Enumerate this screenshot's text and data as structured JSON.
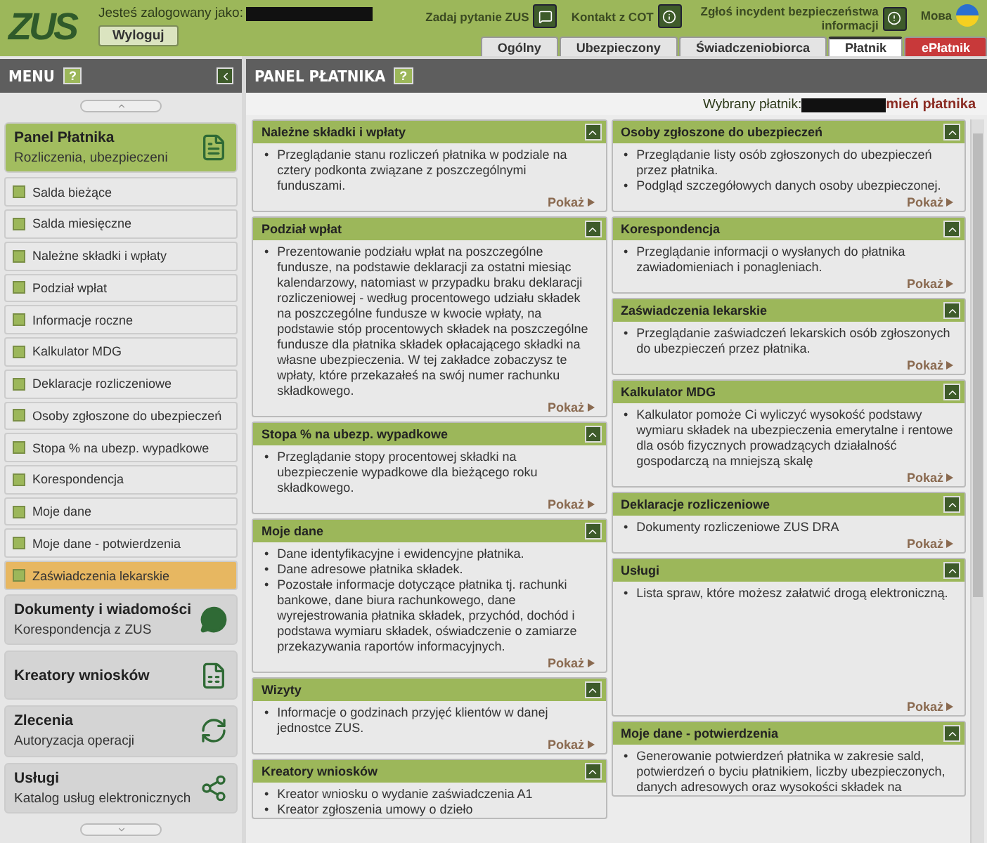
{
  "header": {
    "logo": "ZUS",
    "login_label": "Jesteś zalogowany jako:",
    "logout": "Wyloguj",
    "links": [
      {
        "label": "Zadaj pytanie ZUS",
        "kind": "chat"
      },
      {
        "label": "Kontakt z COT",
        "kind": "info"
      },
      {
        "label": "Zgłoś incydent bezpieczeństwa informacji",
        "kind": "alert"
      }
    ],
    "language": "Мова"
  },
  "tabs": [
    {
      "label": "Ogólny",
      "selected": false,
      "kind": "normal"
    },
    {
      "label": "Ubezpieczony",
      "selected": false,
      "kind": "normal"
    },
    {
      "label": "Świadczeniobiorca",
      "selected": false,
      "kind": "normal"
    },
    {
      "label": "Płatnik",
      "selected": true,
      "kind": "normal"
    },
    {
      "label": "ePłatnik",
      "selected": false,
      "kind": "highlight"
    }
  ],
  "sidebar": {
    "title": "MENU",
    "help": "?",
    "sections": [
      {
        "title": "Panel Płatnika",
        "subtitle": "Rozliczenia, ubezpieczeni",
        "kind": "document",
        "expanded": true,
        "items": [
          {
            "label": "Salda bieżące",
            "selected": false
          },
          {
            "label": "Salda miesięczne",
            "selected": false
          },
          {
            "label": "Należne składki i wpłaty",
            "selected": false
          },
          {
            "label": "Podział wpłat",
            "selected": false
          },
          {
            "label": "Informacje roczne",
            "selected": false
          },
          {
            "label": "Kalkulator MDG",
            "selected": false
          },
          {
            "label": "Deklaracje rozliczeniowe",
            "selected": false
          },
          {
            "label": "Osoby zgłoszone do ubezpieczeń",
            "selected": false
          },
          {
            "label": "Stopa % na ubezp. wypadkowe",
            "selected": false
          },
          {
            "label": "Korespondencja",
            "selected": false
          },
          {
            "label": "Moje dane",
            "selected": false
          },
          {
            "label": "Moje dane - potwierdzenia",
            "selected": false
          },
          {
            "label": "Zaświadczenia lekarskie",
            "selected": true
          }
        ]
      },
      {
        "title": "Dokumenty i wiadomości",
        "subtitle": "Korespondencja z ZUS",
        "kind": "chat",
        "expanded": false
      },
      {
        "title": "Kreatory wniosków",
        "kind": "form",
        "expanded": false
      },
      {
        "title": "Zlecenia",
        "subtitle": "Autoryzacja operacji",
        "kind": "refresh",
        "expanded": false
      },
      {
        "title": "Usługi",
        "subtitle": "Katalog usług elektronicznych",
        "kind": "network",
        "expanded": false
      }
    ]
  },
  "main": {
    "bullet_marker": "•",
    "title": "PANEL PŁATNIKA",
    "help": "?",
    "payer_label": "Wybrany płatnik:",
    "change_payer": "mień płatnika",
    "left_cards": [
      {
        "title": "Należne składki i wpłaty",
        "bullets": [
          "Przeglądanie stanu rozliczeń płatnika w podziale na cztery podkonta związane z poszczególnymi funduszami."
        ],
        "link": "Pokaż"
      },
      {
        "title": "Podział wpłat",
        "bullets": [
          "Prezentowanie podziału wpłat na poszczególne fundusze, na podstawie deklaracji za ostatni miesiąc kalendarzowy, natomiast w przypadku braku deklaracji rozliczeniowej - według procentowego udziału składek na poszczególne fundusze w kwocie wpłaty, na podstawie stóp procentowych składek na poszczególne fundusze dla płatnika składek opłacającego składki na własne ubezpieczenia. W tej zakładce zobaczysz te wpłaty, które przekazałeś na swój numer rachunku składkowego."
        ],
        "link": "Pokaż"
      },
      {
        "title": "Stopa % na ubezp. wypadkowe",
        "bullets": [
          "Przeglądanie stopy procentowej składki na ubezpieczenie wypadkowe dla bieżącego roku składkowego."
        ],
        "link": "Pokaż"
      },
      {
        "title": "Moje dane",
        "bullets": [
          "Dane identyfikacyjne i ewidencyjne płatnika.",
          "Dane adresowe płatnika składek.",
          "Pozostałe informacje dotyczące płatnika tj. rachunki bankowe, dane biura rachunkowego, dane wyrejestrowania płatnika składek, przychód, dochód i podstawa wymiaru składek, oświadczenie o zamiarze przekazywania raportów informacyjnych."
        ],
        "link": "Pokaż"
      },
      {
        "title": "Wizyty",
        "bullets": [
          "Informacje o godzinach przyjęć klientów w danej jednostce ZUS."
        ],
        "link": "Pokaż"
      },
      {
        "title": "Kreatory wniosków",
        "bullets": [
          "Kreator wniosku o wydanie zaświadczenia A1",
          "Kreator zgłoszenia umowy o dzieło"
        ]
      }
    ],
    "right_cards": [
      {
        "title": "Osoby zgłoszone do ubezpieczeń",
        "bullets": [
          "Przeglądanie listy osób zgłoszonych do ubezpieczeń przez płatnika.",
          "Podgląd szczegółowych danych osoby ubezpieczonej."
        ],
        "link": "Pokaż"
      },
      {
        "title": "Korespondencja",
        "bullets": [
          "Przeglądanie informacji o wysłanych do płatnika zawiadomieniach i ponagleniach."
        ],
        "link": "Pokaż"
      },
      {
        "title": "Zaświadczenia lekarskie",
        "bullets": [
          "Przeglądanie zaświadczeń lekarskich osób zgłoszonych do ubezpieczeń przez płatnika."
        ],
        "link": "Pokaż"
      },
      {
        "title": "Kalkulator MDG",
        "bullets": [
          "Kalkulator pomoże Ci wyliczyć wysokość podstawy wymiaru składek na ubezpieczenia emerytalne i rentowe dla osób fizycznych prowadzących działalność gospodarczą na mniejszą skalę"
        ],
        "link": "Pokaż"
      },
      {
        "title": "Deklaracje rozliczeniowe",
        "bullets": [
          "Dokumenty rozliczeniowe ZUS DRA"
        ],
        "link": "Pokaż"
      },
      {
        "title": "Usługi",
        "bullets": [
          "Lista spraw, które możesz załatwić drogą elektroniczną."
        ],
        "link": "Pokaż",
        "tall": true
      },
      {
        "title": "Moje dane - potwierdzenia",
        "bullets": [
          "Generowanie potwierdzeń płatnika w zakresie sald, potwierdzeń o byciu płatnikiem, liczby ubezpieczonych, danych adresowych oraz wysokości składek na"
        ]
      }
    ]
  }
}
